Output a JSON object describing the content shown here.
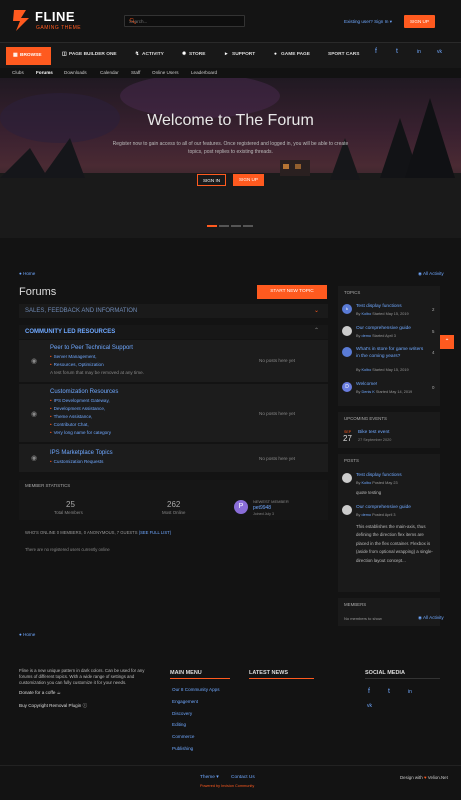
{
  "brand": {
    "name": "FLINE",
    "tagline": "GAMING THEME",
    "accent": "#ff5a1f"
  },
  "header": {
    "search_placeholder": "Search...",
    "existing_user": "Existing user? Sign In ▾",
    "signup": "SIGN UP"
  },
  "nav": {
    "items": [
      {
        "label": "BROWSE",
        "icon": "grid-icon"
      },
      {
        "label": "PAGE BUILDER ONE",
        "icon": "file-icon"
      },
      {
        "label": "ACTIVITY",
        "icon": "pulse-icon"
      },
      {
        "label": "STORE",
        "icon": "tag-icon"
      },
      {
        "label": "SUPPORT",
        "icon": "megaphone-icon"
      },
      {
        "label": "GAME PAGE",
        "icon": "gamepad-icon"
      },
      {
        "label": "SPORT CARS",
        "icon": ""
      }
    ],
    "sub": [
      "Clubs",
      "Forums",
      "Downloads",
      "Calendar",
      "Staff",
      "Online Users",
      "Leaderboard"
    ],
    "socials": [
      "f",
      "t",
      "in",
      "vk"
    ]
  },
  "hero": {
    "title": "Welcome to The Forum",
    "subtitle": "Register now to gain access to all of our features. Once registered and logged in, you will be able to create topics, post replies to existing threads.",
    "signin": "SIGN IN",
    "signup": "SIGN UP"
  },
  "breadcrumb": {
    "home": "Home",
    "all_activity": "All Activity"
  },
  "forums": {
    "title": "Forums",
    "start_topic": "START NEW TOPIC",
    "categories": [
      "SALES, FEEDBACK AND INFORMATION",
      "COMMUNITY LED RESOURCES"
    ],
    "rows": [
      {
        "title": "Peer to Peer Technical Support",
        "subs": [
          "Server Management,",
          "Resources, Optimization"
        ],
        "desc": "A test forum that may be removed at any time.",
        "last": "No posts here yet"
      },
      {
        "title": "Customization Resources",
        "subs": [
          "IPS Development Gateway,",
          "Development Assistance,",
          "Theme Assistance,",
          "Contributor Chat,",
          "Very long name for category"
        ],
        "desc": "",
        "last": "No posts here yet"
      },
      {
        "title": "IPS Marketplace Topics",
        "subs": [
          "Customization Requests"
        ],
        "desc": "",
        "last": "No posts here yet"
      }
    ],
    "stats": {
      "title": "MEMBER STATISTICS",
      "total_members": "25",
      "total_members_label": "Total Members",
      "most_online": "262",
      "most_online_label": "Most Online",
      "newest_label": "NEWEST MEMBER",
      "newest_name": "pet9948",
      "newest_joined": "Joined July 3",
      "newest_initial": "P"
    },
    "online": {
      "label": "WHO'S ONLINE",
      "counts": "0 MEMBERS, 0 ANONYMOUS, 7 GUESTS",
      "see_full": "(SEE FULL LIST)",
      "none": "There are no registered users currently online"
    }
  },
  "sidebar": {
    "topics_title": "TOPICS",
    "topics": [
      {
        "title": "Test display functions",
        "by": "By",
        "author": "Kolbo",
        "started": "Started May 15, 2019",
        "count": "2"
      },
      {
        "title": "Our comprehensive guide",
        "by": "By",
        "author": "demo",
        "started": "Started April 3",
        "count": "5"
      },
      {
        "title": "What's in store for game writers in the coming years?",
        "by": "By",
        "author": "Kolbo",
        "started": "Started May 15, 2019",
        "count": "4"
      },
      {
        "title": "Welcome!",
        "by": "By",
        "author": "Denis K",
        "started": "Started May 14, 2019",
        "count": "0"
      }
    ],
    "events_title": "UPCOMING EVENTS",
    "event": {
      "month": "SEP",
      "day": "27",
      "title": "Bike test event",
      "date": "27 September 2020"
    },
    "posts_title": "POSTS",
    "posts": [
      {
        "title": "Test display functions",
        "by": "By",
        "author": "Kolbo",
        "posted": "Posted May 23",
        "text": "quote testing"
      },
      {
        "title": "Our comprehensive guide",
        "by": "By",
        "author": "demo",
        "posted": "Posted April 3",
        "text": "This establishes the main-axis, thus defining the direction flex items are placed in the flex container. Flexbox is (aside from optional wrapping) a single-direction layout concept..."
      }
    ],
    "members_title": "MEMBERS",
    "members_none": "No members to show"
  },
  "footer": {
    "about": "Fline is a new unique pattern in dark colors. Can be used for any forums of different topics. With a wide range of settings and customization you can fully customize it for your needs.",
    "donate": "Donate for a coffe",
    "copyright": "Buy Copyright Removal Plugin",
    "main_menu_title": "MAIN MENU",
    "main_menu": [
      "Our 8 Community Apps",
      "Engagement",
      "Discovery",
      "Editing",
      "Commerce",
      "Publishing"
    ],
    "latest_title": "LATEST NEWS",
    "social_title": "SOCIAL MEDIA",
    "theme": "Theme ▾",
    "contact": "Contact Us",
    "powered": "Powered by Invision Community",
    "design": "Design with",
    "design_by": "Velion.Net"
  }
}
